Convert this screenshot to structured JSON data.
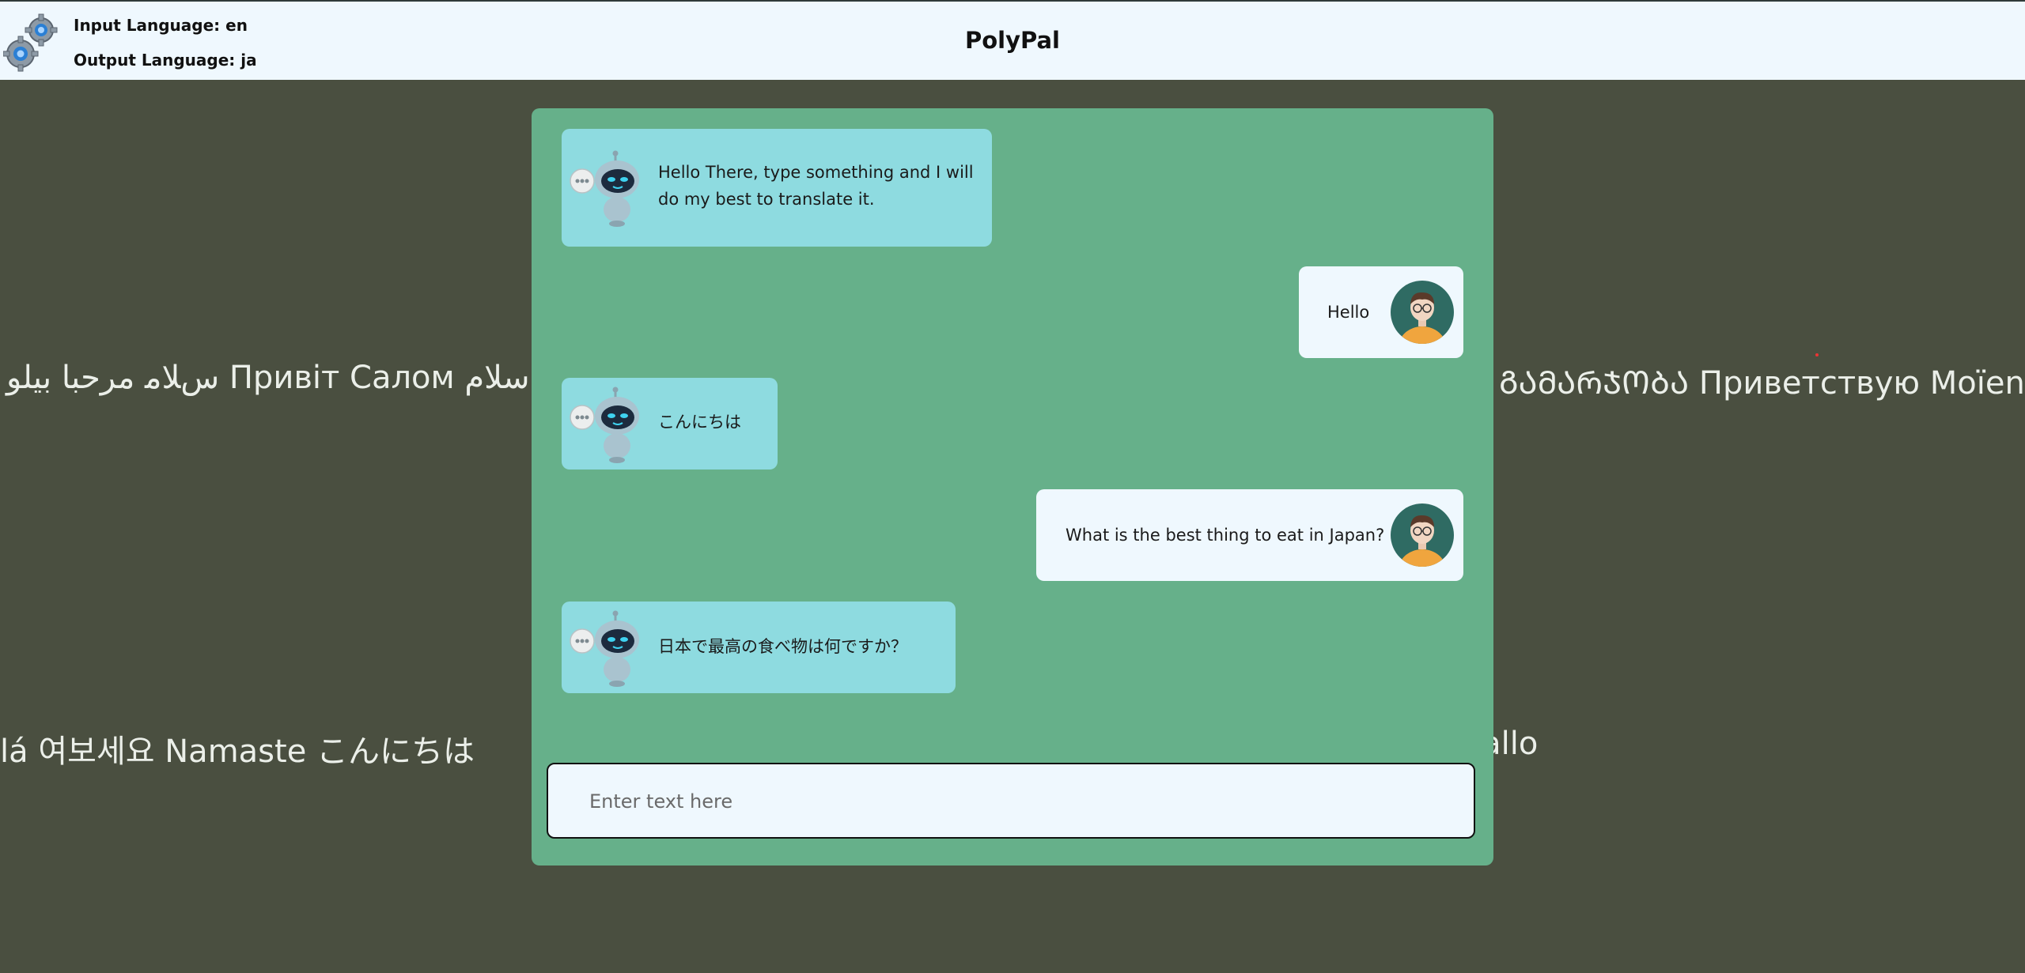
{
  "app": {
    "title": "PolyPal"
  },
  "header": {
    "input_language": "Input Language: en",
    "output_language": "Output Language: ja"
  },
  "background": {
    "marquee_top": "ﺱﻼﻣ مرحبا بیلو Привіт Салом سلام ",
    "marquee_top_right": "ᲒᲐᲛᲐᲠᲯᲝᲑᲐ Приветствую Moïen Nǐn h",
    "marquee_bottom": "lá 여보세요 Namaste こんにちは",
    "marquee_bottom_right": "Hallo"
  },
  "chat": {
    "messages": [
      {
        "role": "bot",
        "text": "Hello There, type something and I will do my best to translate it."
      },
      {
        "role": "user",
        "text": "Hello"
      },
      {
        "role": "bot",
        "text": "こんにちは"
      },
      {
        "role": "user",
        "text": "What is the best thing to eat in Japan?"
      },
      {
        "role": "bot",
        "text": "日本で最高の食べ物は何ですか？"
      }
    ],
    "input": {
      "placeholder": "Enter text here",
      "value": ""
    }
  },
  "icons": {
    "settings": "gear-icon",
    "bot_avatar": "robot-icon",
    "user_avatar": "user-avatar-icon"
  }
}
